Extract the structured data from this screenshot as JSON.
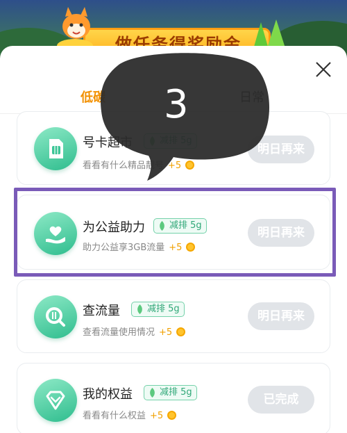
{
  "banner": {
    "title": "做任务得奖励金"
  },
  "tabs": [
    {
      "label": "低碳",
      "active": true
    },
    {
      "label": "日常",
      "active": false
    }
  ],
  "overlay": {
    "number": "3"
  },
  "tasks": [
    {
      "title": "号卡超市",
      "badge": "减排 5g",
      "desc": "看看有什么精品靓号",
      "reward": "+5",
      "action": "明日再来",
      "icon": "sim-card-icon"
    },
    {
      "title": "为公益助力",
      "badge": "减排 5g",
      "desc": "助力公益享3GB流量",
      "reward": "+5",
      "action": "明日再来",
      "icon": "heart-hand-icon"
    },
    {
      "title": "查流量",
      "badge": "减排 5g",
      "desc": "查看流量使用情况",
      "reward": "+5",
      "action": "明日再来",
      "icon": "data-usage-icon"
    },
    {
      "title": "我的权益",
      "badge": "减排 5g",
      "desc": "看看有什么权益",
      "reward": "+5",
      "action": "已完成",
      "icon": "diamond-icon"
    }
  ],
  "colors": {
    "accent": "#f29000",
    "green": "#2fbd8e",
    "highlight": "#7a5bb8",
    "disabled": "#e1e4e8"
  }
}
